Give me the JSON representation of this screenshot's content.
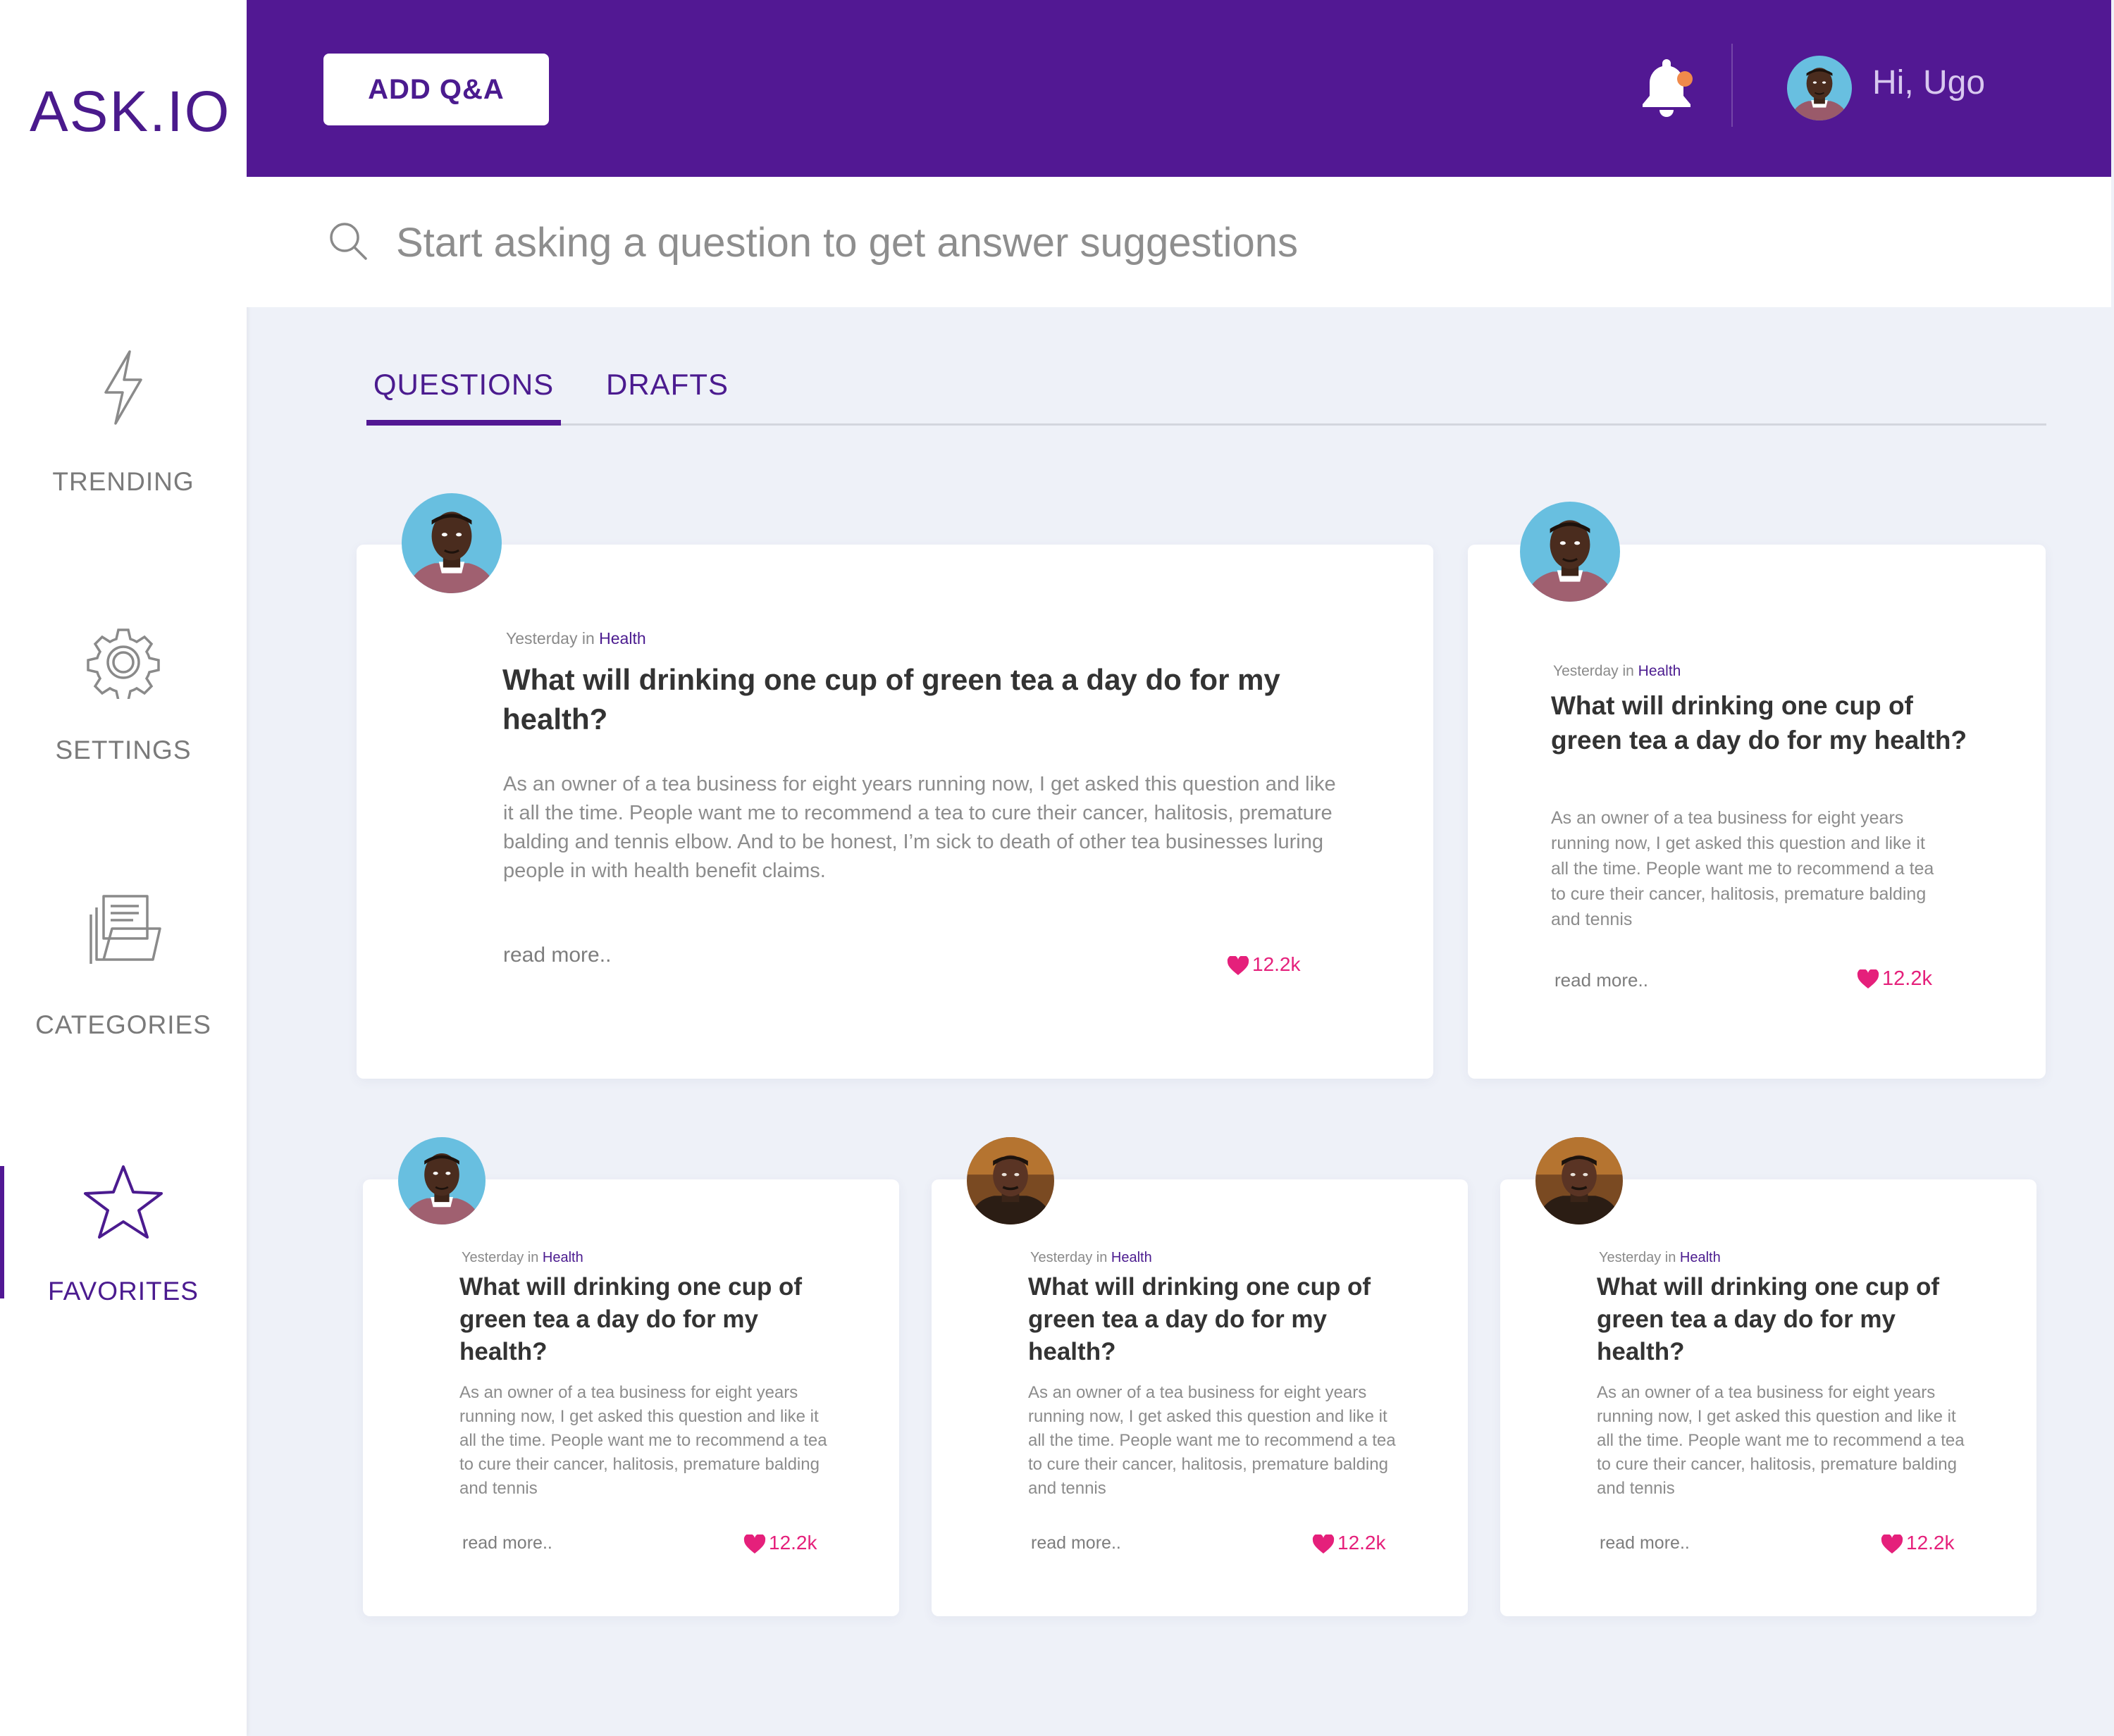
{
  "sidebar": {
    "logo": "ASK.IO",
    "items": [
      {
        "label": "TRENDING",
        "icon": "lightning-icon"
      },
      {
        "label": "SETTINGS",
        "icon": "gear-icon"
      },
      {
        "label": "CATEGORIES",
        "icon": "folder-icon"
      },
      {
        "label": "FAVORITES",
        "icon": "star-icon",
        "active": true
      }
    ]
  },
  "header": {
    "add_button": "ADD Q&A",
    "greeting": "Hi, Ugo",
    "notification_dot_color": "#f08a4b"
  },
  "search": {
    "placeholder": "Start asking a question to get answer suggestions"
  },
  "tabs": [
    {
      "label": "QUESTIONS",
      "active": true
    },
    {
      "label": "DRAFTS",
      "active": false
    }
  ],
  "cards": [
    {
      "time": "Yesterday in",
      "category": "Health",
      "title": "What will drinking one cup of green tea a day do for my health?",
      "body": "As an owner of a tea business for eight years running now, I get asked this question and like it all the time.  People want me to recommend a tea to cure their cancer, halitosis, premature balding and tennis elbow.  And to be honest, I’m sick to death of other tea businesses luring people in with health benefit claims.",
      "read_more": "read more..",
      "likes": "12.2k"
    },
    {
      "time": "Yesterday in",
      "category": "Health",
      "title": "What will drinking one cup of green tea a day do for my health?",
      "body": "As an owner of a tea business for eight years running now, I get asked this question and like it all the time.  People want me to recommend a tea to cure their cancer, halitosis, premature balding and tennis",
      "read_more": "read more..",
      "likes": "12.2k"
    },
    {
      "time": "Yesterday in",
      "category": "Health",
      "title": "What will drinking one cup of green tea a day do for my health?",
      "body": "As an owner of a tea business for eight years running now, I get asked this question and like it all the time.  People want me to recommend a tea to cure their cancer, halitosis, premature balding and tennis",
      "read_more": "read more..",
      "likes": "12.2k"
    },
    {
      "time": "Yesterday in",
      "category": "Health",
      "title": "What will drinking one cup of green tea a day do for my health?",
      "body": "As an owner of a tea business for eight years running now, I get asked this question and like it all the time.  People want me to recommend a tea to cure their cancer, halitosis, premature balding and tennis",
      "read_more": "read more..",
      "likes": "12.2k"
    },
    {
      "time": "Yesterday in",
      "category": "Health",
      "title": "What will drinking one cup of green tea a day do for my health?",
      "body": "As an owner of a tea business for eight years running now, I get asked this question and like it all the time.  People want me to recommend a tea to cure their cancer, halitosis, premature balding and tennis",
      "read_more": "read more..",
      "likes": "12.2k"
    }
  ],
  "colors": {
    "brand": "#521893",
    "accent_text": "#4b1b8f",
    "like": "#e5207b",
    "background": "#eef1f8"
  }
}
